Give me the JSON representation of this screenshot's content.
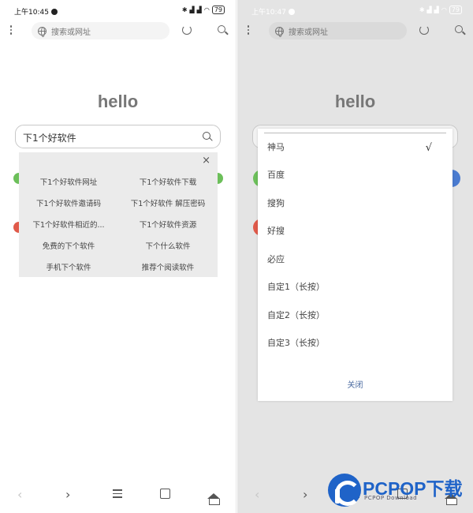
{
  "left": {
    "status": {
      "time": "上午10:45",
      "battery": "79"
    },
    "url_placeholder": "搜索或网址",
    "hello": "hello",
    "search_query": "下1个好软件",
    "suggest_close": "×",
    "suggestions": [
      "下1个好软件网址",
      "下1个好软件下载",
      "下1个好软件邀请码",
      "下1个好软件 解压密码",
      "下1个好软件相近的...",
      "下1个好软件资源",
      "免费的下个软件",
      "下个什么软件",
      "手机下个软件",
      "推荐个阅读软件"
    ]
  },
  "right": {
    "status": {
      "time": "上午10:47",
      "battery": "79"
    },
    "url_placeholder": "搜索或网址",
    "hello": "hello",
    "engines": [
      "神马",
      "百度",
      "搜狗",
      "好搜",
      "必应",
      "自定1（长按）",
      "自定2（长按）",
      "自定3（长按）"
    ],
    "selected_engine": "神马",
    "check_mark": "√",
    "close_label": "关闭"
  },
  "icons": {
    "back": "‹",
    "forward": "›"
  },
  "colors": {
    "green_dot": "#6cbf5a",
    "red_dot": "#e05a4a",
    "blue_dot": "#4a7bd0",
    "brand": "#1f63c8"
  },
  "watermark": {
    "brand": "PCPOP下载",
    "sub": "PCPOP Download"
  }
}
